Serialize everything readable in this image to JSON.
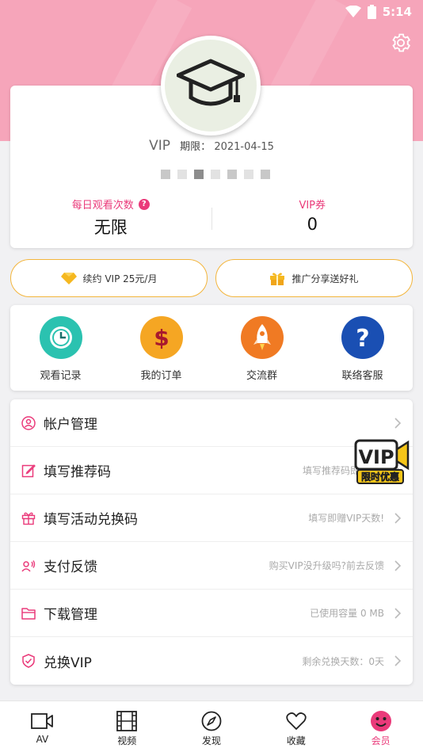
{
  "status_bar": {
    "time": "5:14",
    "wifi_icon": "wifi-icon",
    "battery_icon": "battery-icon"
  },
  "header": {
    "settings_icon": "gear-icon",
    "bg_color": "#f59bb3"
  },
  "profile": {
    "avatar_icon": "graduation-cap-icon",
    "vip_tag": "VIP",
    "expiry_label": "期限：",
    "expiry_date": "2021-04-15",
    "stats": [
      {
        "label": "每日观看次数",
        "value": "无限",
        "has_help": true
      },
      {
        "label": "VIP券",
        "value": "0",
        "has_help": false
      }
    ],
    "help_symbol": "?"
  },
  "promos": [
    {
      "icon": "diamond-icon",
      "label": "续约 VIP 25元/月"
    },
    {
      "icon": "gift-icon",
      "label": "推广分享送好礼"
    }
  ],
  "quick_actions": [
    {
      "icon": "clock-icon",
      "label": "观看记录",
      "color": "#2bc2b0"
    },
    {
      "icon": "dollar-icon",
      "label": "我的订单",
      "color": "#f5a623"
    },
    {
      "icon": "rocket-icon",
      "label": "交流群",
      "color": "#f07a23"
    },
    {
      "icon": "question-icon",
      "label": "联络客服",
      "color": "#1a4fb3"
    }
  ],
  "menu": [
    {
      "icon": "user-icon",
      "label": "帐户管理",
      "hint": ""
    },
    {
      "icon": "edit-icon",
      "label": "填写推荐码",
      "hint": "填写推荐码即赠VIP"
    },
    {
      "icon": "gift-icon",
      "label": "填写活动兑换码",
      "hint": "填写即赠VIP天数!"
    },
    {
      "icon": "feedback-icon",
      "label": "支付反馈",
      "hint": "购买VIP没升级吗?前去反馈"
    },
    {
      "icon": "folder-icon",
      "label": "下载管理",
      "hint": "已使用容量 0 MB"
    },
    {
      "icon": "shield-check-icon",
      "label": "兑换VIP",
      "hint": "剩余兑换天数：0天"
    }
  ],
  "vip_badge": {
    "title": "VIP",
    "subtitle": "限时优惠"
  },
  "bottom_nav": [
    {
      "icon": "video-camera-icon",
      "label": "AV",
      "active": false
    },
    {
      "icon": "film-icon",
      "label": "视频",
      "active": false
    },
    {
      "icon": "compass-icon",
      "label": "发现",
      "active": false
    },
    {
      "icon": "heart-icon",
      "label": "收藏",
      "active": false
    },
    {
      "icon": "smiley-icon",
      "label": "会员",
      "active": true
    }
  ],
  "accent_color": "#ea3a7a"
}
